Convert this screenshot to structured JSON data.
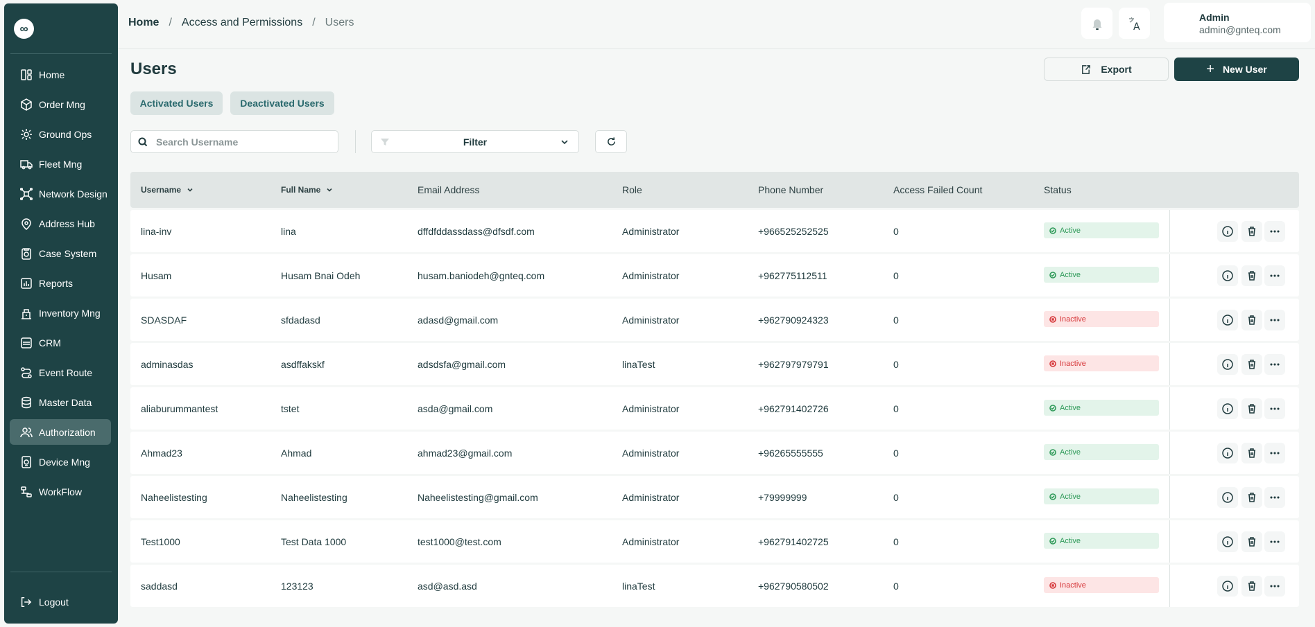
{
  "sidebar": {
    "logo": "∞",
    "items": [
      {
        "label": "Home",
        "icon": "dashboard-icon",
        "active": false
      },
      {
        "label": "Order Mng",
        "icon": "order-icon",
        "active": false
      },
      {
        "label": "Ground Ops",
        "icon": "ground-ops-icon",
        "active": false
      },
      {
        "label": "Fleet Mng",
        "icon": "truck-icon",
        "active": false
      },
      {
        "label": "Network Design",
        "icon": "network-icon",
        "active": false
      },
      {
        "label": "Address Hub",
        "icon": "map-pin-icon",
        "active": false
      },
      {
        "label": "Case System",
        "icon": "case-icon",
        "active": false
      },
      {
        "label": "Reports",
        "icon": "reports-icon",
        "active": false
      },
      {
        "label": "Inventory Mng",
        "icon": "inventory-icon",
        "active": false
      },
      {
        "label": "CRM",
        "icon": "crm-icon",
        "active": false
      },
      {
        "label": "Event Route",
        "icon": "route-icon",
        "active": false
      },
      {
        "label": "Master Data",
        "icon": "database-icon",
        "active": false
      },
      {
        "label": "Authorization",
        "icon": "users-icon",
        "active": true
      },
      {
        "label": "Device Mng",
        "icon": "device-icon",
        "active": false
      },
      {
        "label": "WorkFlow",
        "icon": "workflow-icon",
        "active": false
      }
    ],
    "logout_label": "Logout"
  },
  "header": {
    "breadcrumb": [
      "Home",
      "Access and Permissions",
      "Users"
    ],
    "breadcrumb_separator": "/",
    "language_letter": "A",
    "user_name": "Admin",
    "user_email": "admin@gnteq.com"
  },
  "page": {
    "title": "Users",
    "export_label": "Export",
    "new_user_label": "New User",
    "tabs": [
      "Activated Users",
      "Deactivated Users"
    ],
    "search_placeholder": "Search Username",
    "filter_label": "Filter"
  },
  "table": {
    "columns": [
      "Username",
      "Full Name",
      "Email Address",
      "Role",
      "Phone Number",
      "Access Failed Count",
      "Status"
    ],
    "rows": [
      {
        "username": "lina-inv",
        "full_name": "lina",
        "email": "dffdfddassdass@dfsdf.com",
        "role": "Administrator",
        "phone": "+966525252525",
        "failed": "0",
        "status": "Active"
      },
      {
        "username": "Husam",
        "full_name": "Husam Bnai Odeh",
        "email": "husam.baniodeh@gnteq.com",
        "role": "Administrator",
        "phone": "+962775112511",
        "failed": "0",
        "status": "Active"
      },
      {
        "username": "SDASDAF",
        "full_name": "sfdadasd",
        "email": "adasd@gmail.com",
        "role": "Administrator",
        "phone": "+962790924323",
        "failed": "0",
        "status": "Inactive"
      },
      {
        "username": "adminasdas",
        "full_name": "asdffakskf",
        "email": "adsdsfa@gmail.com",
        "role": "linaTest",
        "phone": "+962797979791",
        "failed": "0",
        "status": "Inactive"
      },
      {
        "username": "aliaburummantest",
        "full_name": "tstet",
        "email": "asda@gmail.com",
        "role": "Administrator",
        "phone": "+962791402726",
        "failed": "0",
        "status": "Active"
      },
      {
        "username": "Ahmad23",
        "full_name": "Ahmad",
        "email": "ahmad23@gmail.com",
        "role": "Administrator",
        "phone": "+96265555555",
        "failed": "0",
        "status": "Active"
      },
      {
        "username": "Naheelistesting",
        "full_name": "Naheelistesting",
        "email": "Naheelistesting@gmail.com",
        "role": "Administrator",
        "phone": "+79999999",
        "failed": "0",
        "status": "Active"
      },
      {
        "username": "Test1000",
        "full_name": "Test Data 1000",
        "email": "test1000@test.com",
        "role": "Administrator",
        "phone": "+962791402725",
        "failed": "0",
        "status": "Active"
      },
      {
        "username": "saddasd",
        "full_name": "123123",
        "email": "asd@asd.asd",
        "role": "linaTest",
        "phone": "+962790580502",
        "failed": "0",
        "status": "Inactive"
      }
    ]
  },
  "colors": {
    "sidebar_bg": "#1e4345",
    "active_nav": "#4a6b6c",
    "primary": "#1e4345",
    "active_badge": "#2f9a59",
    "inactive_badge": "#d6373a"
  }
}
